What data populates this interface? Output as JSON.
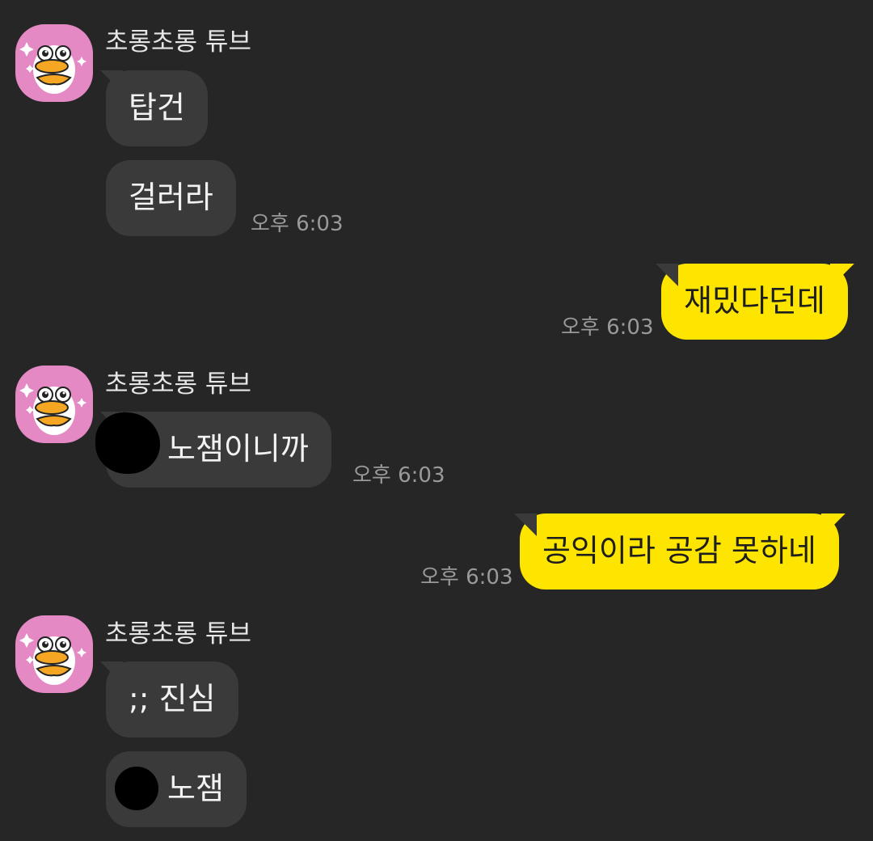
{
  "chat": {
    "sender_name": "초롱초롱 튜브",
    "messages": [
      {
        "text": "탑건"
      },
      {
        "text": "걸러라",
        "time": "오후 6:03"
      },
      {
        "text": "재밌다던데",
        "time": "오후 6:03"
      },
      {
        "text": "노잼이니까",
        "time": "오후 6:03"
      },
      {
        "text": "공익이라 공감 못하네",
        "time": "오후 6:03"
      },
      {
        "text": ";; 진심"
      },
      {
        "text": "노잼"
      }
    ]
  },
  "colors": {
    "background": "#262626",
    "incoming_bubble": "#3a3a3a",
    "outgoing_bubble": "#fee500",
    "avatar_bg": "#e489c4",
    "timestamp": "#9a9a9a"
  },
  "icons": {
    "avatar": "duck-character-avatar",
    "censor": "black-scribble-redaction"
  }
}
